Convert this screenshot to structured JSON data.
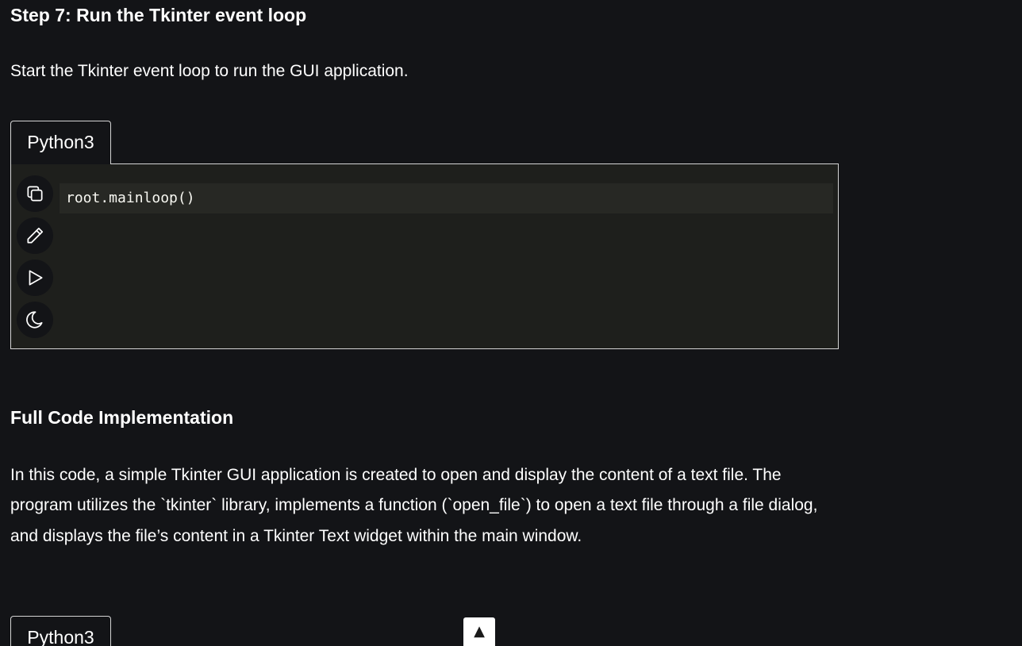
{
  "section1": {
    "heading": "Step 7: Run the Tkinter event loop",
    "description": "Start the Tkinter event loop to run the GUI application."
  },
  "code_block_1": {
    "language_tab": "Python3",
    "code": "root.mainloop()",
    "tools": [
      {
        "name": "copy",
        "icon": "copy-icon"
      },
      {
        "name": "edit",
        "icon": "pencil-icon"
      },
      {
        "name": "run",
        "icon": "play-icon"
      },
      {
        "name": "theme",
        "icon": "moon-icon"
      }
    ]
  },
  "section2": {
    "heading": "Full Code Implementation",
    "description": "In this code, a simple Tkinter GUI application is created to open and display the content of a text file. The program utilizes the `tkinter` library, implements a function (`open_file`) to open a text file through a file dialog, and displays the file’s content in a Tkinter Text widget within the main window."
  },
  "code_block_2": {
    "language_tab": "Python3"
  },
  "scroll_top": {
    "label": "▲"
  },
  "colors": {
    "page_background": "#131417",
    "code_background": "#1e1f1c",
    "code_line_highlight": "#272824",
    "border": "#d4d4d4",
    "text": "#ffffff"
  }
}
